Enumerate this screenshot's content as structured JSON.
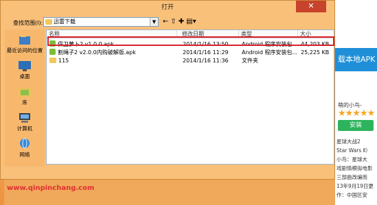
{
  "dialog": {
    "title": "打开",
    "close_label": "✕",
    "look_in_label": "查找范围(I):",
    "current_folder": "迅雷下载"
  },
  "places": [
    {
      "label": "最近访问的位置",
      "icon": "recent-places-icon"
    },
    {
      "label": "桌面",
      "icon": "desktop-icon"
    },
    {
      "label": "库",
      "icon": "libraries-icon"
    },
    {
      "label": "计算机",
      "icon": "computer-icon"
    },
    {
      "label": "网络",
      "icon": "network-icon"
    }
  ],
  "columns": [
    "名称",
    "修改日期",
    "类型",
    "大小"
  ],
  "files": [
    {
      "name": "保卫萝卜2 v1.0.0.apk",
      "date": "2014/1/16 13:50",
      "type": "Android 程序安装包...",
      "size": "44,203 KB",
      "icon": "apk"
    },
    {
      "name": "割绳子2 v2.0.0内购破解版.apk",
      "date": "2014/1/16 11:29",
      "type": "Android 程序安装包...",
      "size": "25,225 KB",
      "icon": "apk"
    },
    {
      "name": "115",
      "date": "2014/1/16 11:36",
      "type": "文件夹",
      "size": "",
      "icon": "folder"
    }
  ],
  "background": {
    "banner": "载本地APK",
    "game_title": "萌的小鸟-",
    "stars": "★★★★★",
    "install": "安装",
    "desc_lines": [
      "星球大战2",
      "Star Wars Ⅱ）",
      "小鸟：星球大",
      "戏剧情模拟电影",
      "三部曲改编而",
      "13年9月19日更",
      "作：中国区安"
    ]
  },
  "watermark": "www.qinpinchang.com"
}
